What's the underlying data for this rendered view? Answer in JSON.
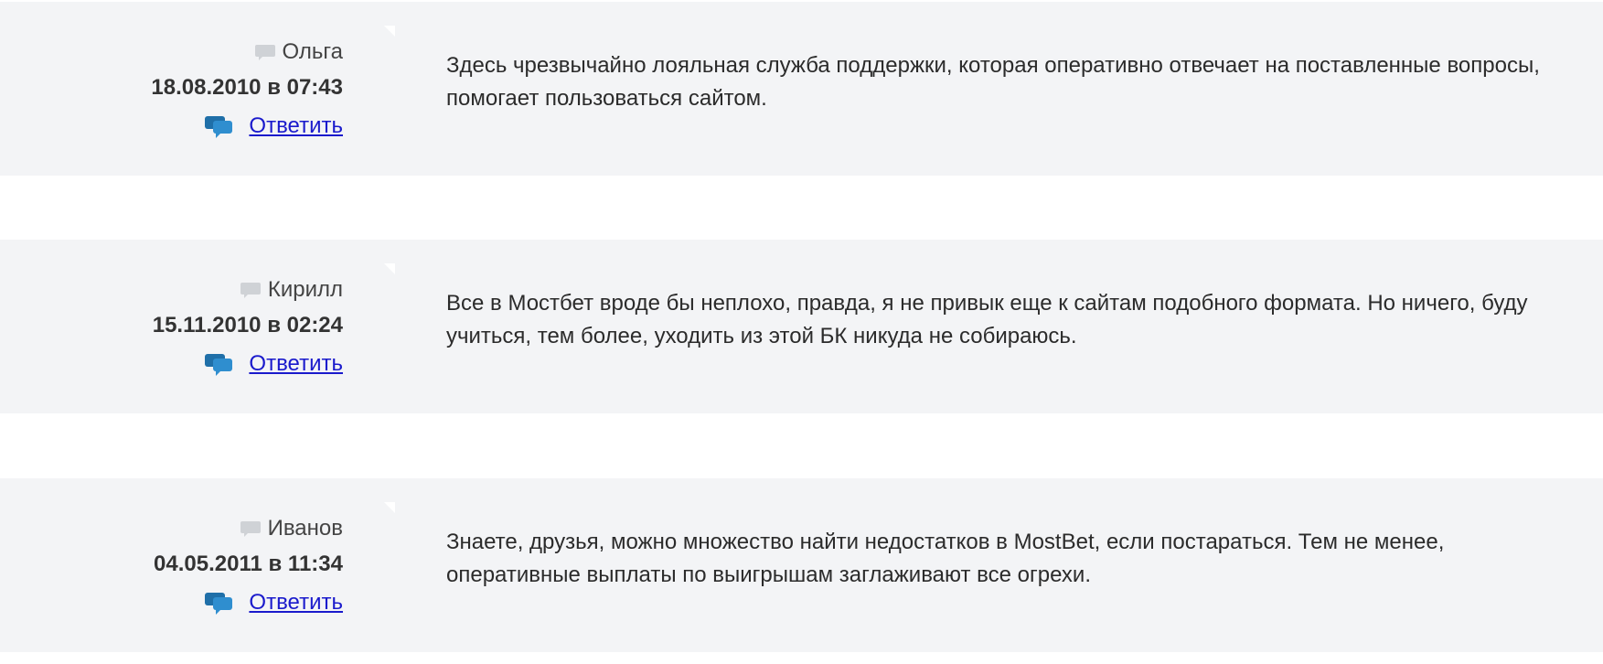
{
  "comments": [
    {
      "author": "Ольга",
      "date": "18.08.2010 в 07:43",
      "reply_label": "Ответить",
      "text": "Здесь чрезвычайно лояльная служба поддержки, которая оперативно отвечает на поставленные вопросы, помогает пользоваться сайтом."
    },
    {
      "author": "Кирилл",
      "date": "15.11.2010 в 02:24",
      "reply_label": "Ответить",
      "text": "Все в Мостбет вроде бы неплохо, правда, я не привык еще к сайтам подобного формата. Но ничего, буду учиться, тем более, уходить из этой БК никуда не собираюсь."
    },
    {
      "author": "Иванов",
      "date": "04.05.2011 в 11:34",
      "reply_label": "Ответить",
      "text": "Знаете, друзья, можно множество найти недостатков в MostBet, если постараться. Тем не менее, оперативные выплаты по выигрышам заглаживают все огрехи."
    }
  ],
  "icons": {
    "author": "comment-bubble-icon",
    "reply": "reply-chat-icon"
  },
  "colors": {
    "card_background": "#f3f4f6",
    "link": "#1a1acc",
    "reply_icon": "#2f8ecf"
  }
}
